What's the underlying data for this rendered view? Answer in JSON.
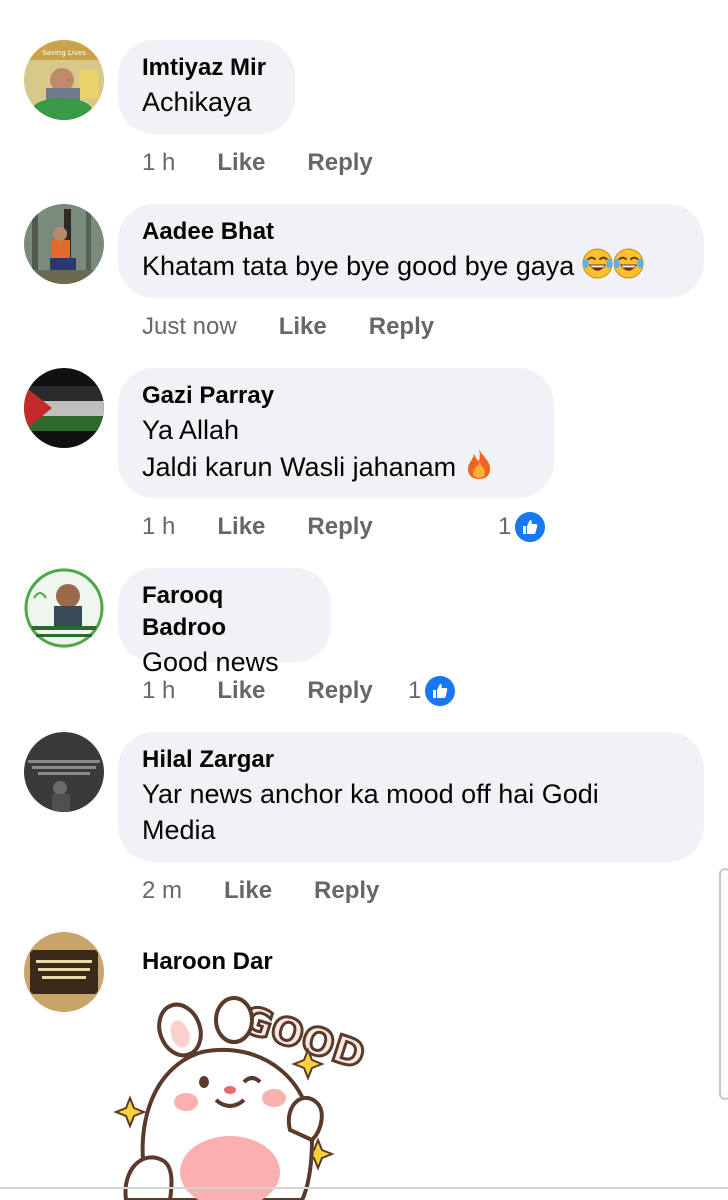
{
  "comments": [
    {
      "name": "Imtiyaz Mir",
      "lines": [
        "Achikaya"
      ],
      "time": "1 h",
      "like": "Like",
      "reply": "Reply",
      "reactions": ""
    },
    {
      "name": "Aadee Bhat",
      "lines": [
        "Khatam tata bye bye good bye gaya"
      ],
      "time": "Just now",
      "like": "Like",
      "reply": "Reply",
      "reactions": ""
    },
    {
      "name": "Gazi Parray",
      "lines": [
        "Ya Allah",
        "Jaldi karun Wasli jahanam"
      ],
      "time": "1 h",
      "like": "Like",
      "reply": "Reply",
      "reactions": "1"
    },
    {
      "name": "Farooq Badroo",
      "lines": [
        "Good news"
      ],
      "time": "1 h",
      "like": "Like",
      "reply": "Reply",
      "reactions": "1"
    },
    {
      "name": "Hilal Zargar",
      "lines": [
        "Yar news anchor ka mood off hai Godi",
        "Media"
      ],
      "time": "2 m",
      "like": "Like",
      "reply": "Reply",
      "reactions": ""
    },
    {
      "name": "Haroon Dar",
      "sticker_text": "GOOD"
    }
  ],
  "avatar_texts": {
    "imtiyaz": "Saving Lives"
  },
  "colors": {
    "bubble": "#f0f2f5",
    "meta": "#65676b",
    "like_blue": "#1877f2"
  }
}
